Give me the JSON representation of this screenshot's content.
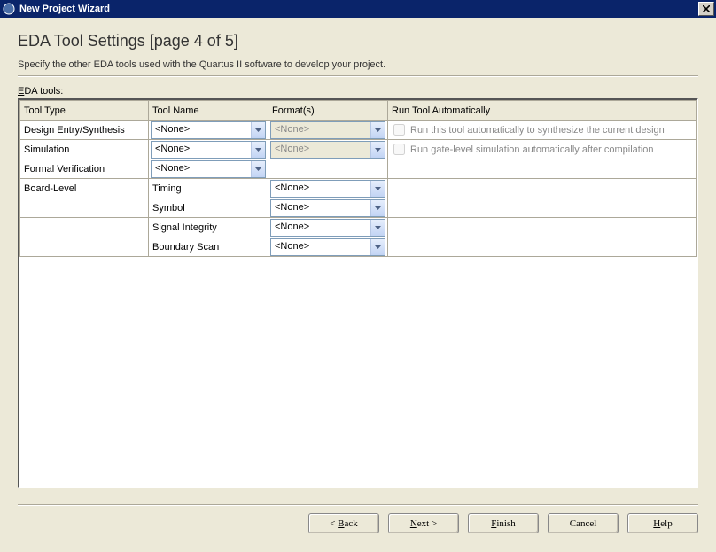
{
  "window": {
    "title": "New Project Wizard"
  },
  "page": {
    "title": "EDA Tool Settings [page 4 of 5]",
    "subtitle": "Specify the other EDA tools used with the Quartus II software to develop your project.",
    "section_label": "EDA tools:"
  },
  "table": {
    "headers": {
      "tool_type": "Tool Type",
      "tool_name": "Tool Name",
      "formats": "Format(s)",
      "auto": "Run Tool Automatically"
    },
    "rows": {
      "design_entry": {
        "type": "Design Entry/Synthesis",
        "name": "<None>",
        "format": "<None>",
        "auto_label": "Run this tool automatically to synthesize the current design"
      },
      "simulation": {
        "type": "Simulation",
        "name": "<None>",
        "format": "<None>",
        "auto_label": "Run gate-level simulation automatically after compilation"
      },
      "formal_verification": {
        "type": "Formal Verification",
        "name": "<None>"
      },
      "board_level": {
        "type": "Board-Level",
        "sub": {
          "timing": {
            "label": "Timing",
            "format": "<None>"
          },
          "symbol": {
            "label": "Symbol",
            "format": "<None>"
          },
          "signal_integrity": {
            "label": "Signal Integrity",
            "format": "<None>"
          },
          "boundary_scan": {
            "label": "Boundary Scan",
            "format": "<None>"
          }
        }
      }
    }
  },
  "buttons": {
    "back": "< Back",
    "next": "Next >",
    "finish": "Finish",
    "cancel": "Cancel",
    "help": "Help"
  }
}
